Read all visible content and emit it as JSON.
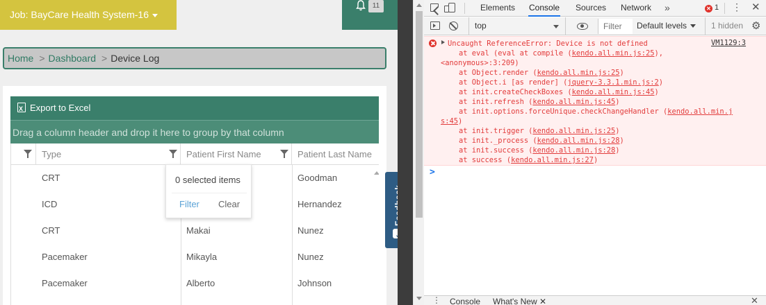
{
  "app": {
    "job_selector": "Job: BayCare Health System-16",
    "notification_count": "11",
    "breadcrumb": {
      "home": "Home",
      "dashboard": "Dashboard",
      "current": "Device Log",
      "separator": ">"
    },
    "grid": {
      "export_label": "Export to Excel",
      "group_hint": "Drag a column header and drop it here to group by that column",
      "columns": [
        "Type",
        "Patient First Name",
        "Patient Last Name"
      ],
      "rows": [
        {
          "type": "CRT",
          "first": "",
          "last": "Goodman"
        },
        {
          "type": "ICD",
          "first": "",
          "last": "Hernandez"
        },
        {
          "type": "CRT",
          "first": "Makai",
          "last": "Nunez"
        },
        {
          "type": "Pacemaker",
          "first": "Mikayla",
          "last": "Nunez"
        },
        {
          "type": "Pacemaker",
          "first": "Alberto",
          "last": "Johnson"
        }
      ]
    },
    "filter_popup": {
      "selected": "0 selected items",
      "filter": "Filter",
      "clear": "Clear"
    },
    "feedback_label": "Feedback",
    "colors": {
      "brand_green": "#3a7f6b",
      "brand_yellow": "#d4c43f",
      "feedback_blue": "#2e5c84"
    }
  },
  "devtools": {
    "tabs": [
      "Elements",
      "Console",
      "Sources",
      "Network"
    ],
    "active_tab": "Console",
    "more_tabs": "»",
    "error_count": "1",
    "context": "top",
    "filter_placeholder": "Filter",
    "levels": "Default levels",
    "hidden": "1 hidden",
    "error_source": "VM1129:3",
    "error_lines": [
      {
        "text": "Uncaught ReferenceError: Device is not defined",
        "link": ""
      },
      {
        "text": "at eval (eval at compile (",
        "link": "kendo.all.min.js:25",
        "suffix": "),"
      },
      {
        "text": "<anonymous>:3:209)",
        "link": "",
        "wrap": true
      },
      {
        "text": "at Object.render (",
        "link": "kendo.all.min.js:25",
        "suffix": ")"
      },
      {
        "text": "at Object.i [as render] (",
        "link": "jquery-3.3.1.min.js:2",
        "suffix": ")"
      },
      {
        "text": "at init.createCheckBoxes (",
        "link": "kendo.all.min.js:45",
        "suffix": ")"
      },
      {
        "text": "at init.refresh (",
        "link": "kendo.all.min.js:45",
        "suffix": ")"
      },
      {
        "text": "at init.options.forceUnique.checkChangeHandler (",
        "link": "kendo.all.min.j",
        "suffix": ""
      },
      {
        "text": "",
        "link": "s:45",
        "suffix": ")",
        "wrap": true
      },
      {
        "text": "at init.trigger (",
        "link": "kendo.all.min.js:25",
        "suffix": ")"
      },
      {
        "text": "at init._process (",
        "link": "kendo.all.min.js:28",
        "suffix": ")"
      },
      {
        "text": "at init.success (",
        "link": "kendo.all.min.js:28",
        "suffix": ")"
      },
      {
        "text": "at success (",
        "link": "kendo.all.min.js:27",
        "suffix": ")"
      }
    ],
    "prompt": ">",
    "drawer_tabs": [
      "Console",
      "What's New"
    ],
    "colors": {
      "error_red": "#e23b3b",
      "error_bg": "#fff0f0",
      "accent_blue": "#1a73e8"
    }
  }
}
